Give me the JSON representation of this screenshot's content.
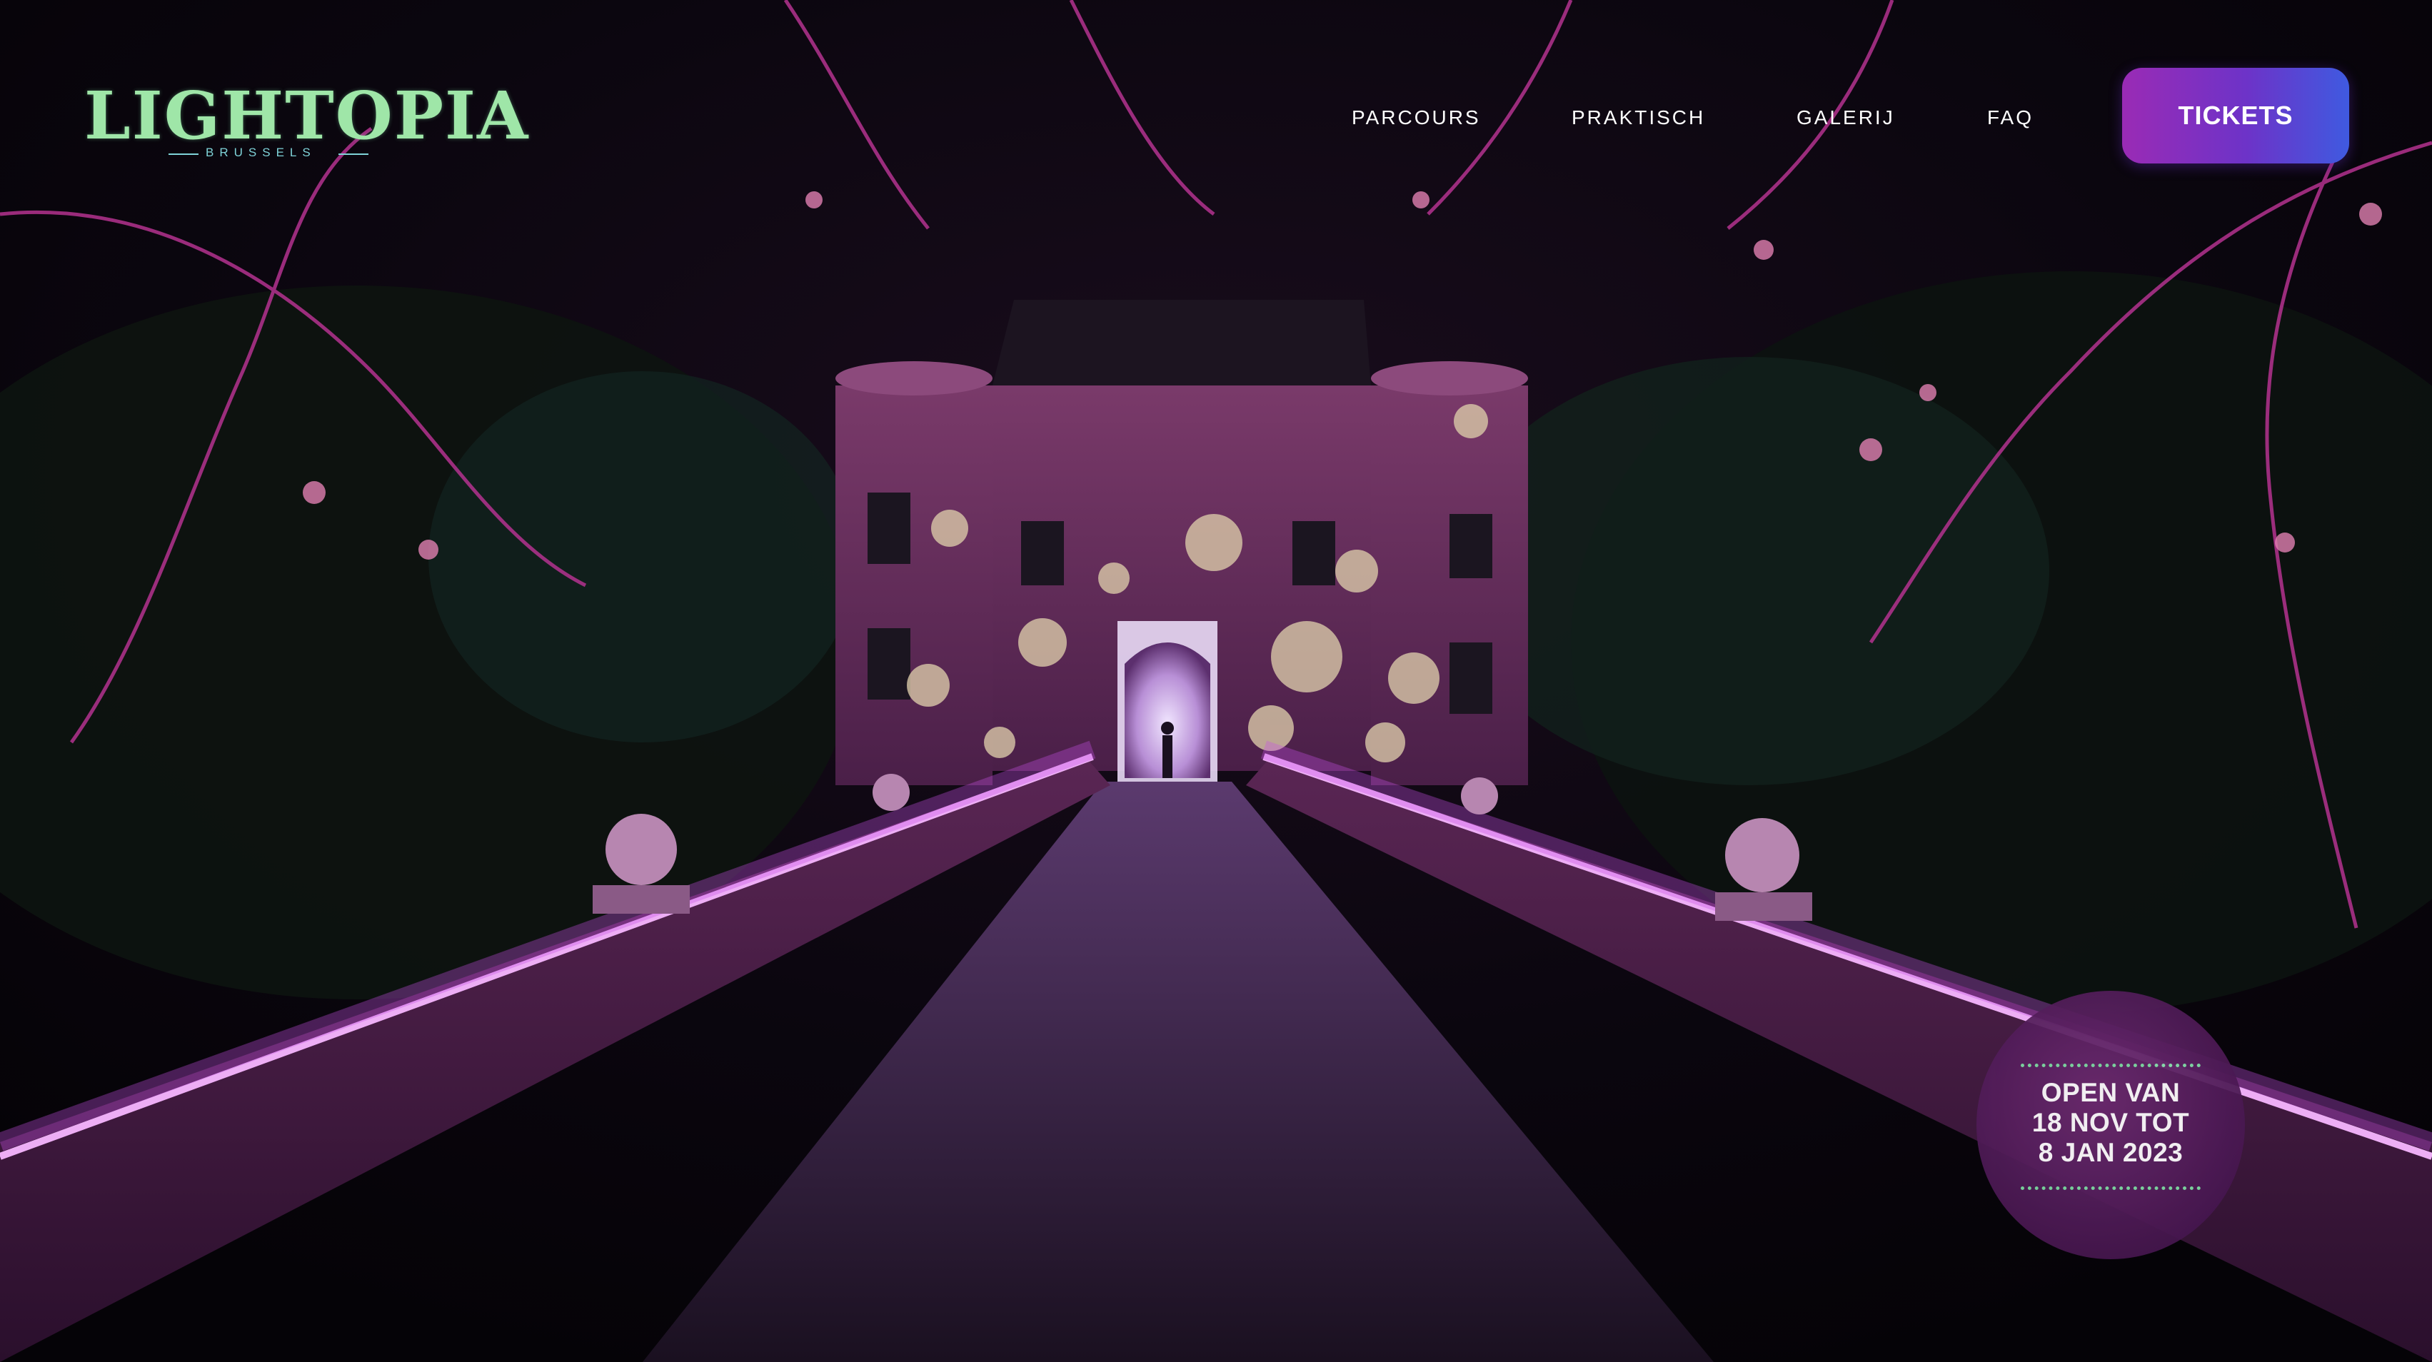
{
  "header": {
    "logo": {
      "wordmark": "LIGHTOPIA",
      "subtitle": "BRUSSELS"
    },
    "nav": [
      {
        "label": "PARCOURS"
      },
      {
        "label": "PRAKTISCH"
      },
      {
        "label": "GALERIJ"
      },
      {
        "label": "FAQ"
      }
    ],
    "tickets_label": "TICKETS"
  },
  "badge": {
    "line1": "OPEN VAN",
    "line2": "18 NOV TOT",
    "line3": "8 JAN 2023"
  },
  "colors": {
    "accent_start": "#9a2bb5",
    "accent_end": "#3f5ae0",
    "badge_bg": "#5a1f60",
    "dots": "#7fdca4",
    "night_purple": "#b4328f"
  }
}
